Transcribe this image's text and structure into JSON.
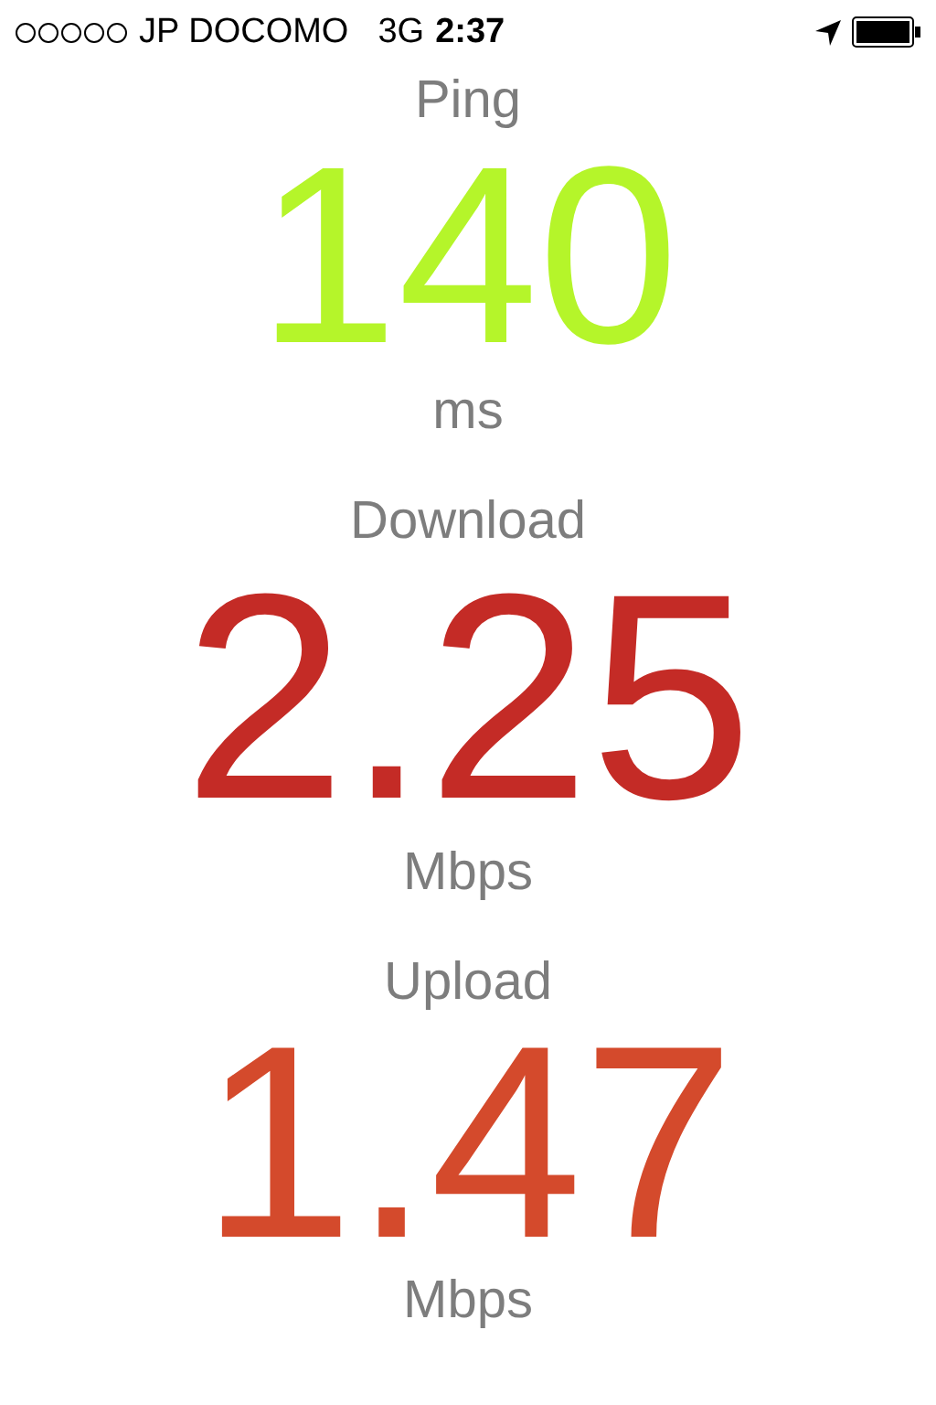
{
  "status_bar": {
    "carrier": "JP DOCOMO",
    "network": "3G",
    "time": "2:37"
  },
  "metrics": [
    {
      "label": "Ping",
      "value": "140",
      "unit": "ms",
      "color": "#b5f52a"
    },
    {
      "label": "Download",
      "value": "2.25",
      "unit": "Mbps",
      "color": "#c42b26"
    },
    {
      "label": "Upload",
      "value": "1.47",
      "unit": "Mbps",
      "color": "#d44a2c"
    }
  ]
}
